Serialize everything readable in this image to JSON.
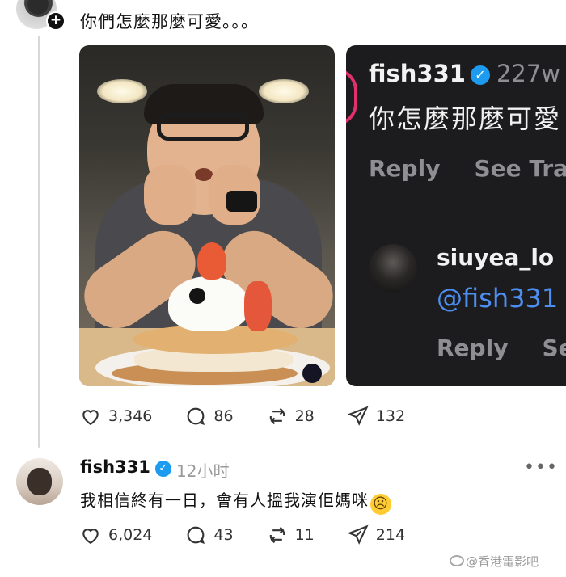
{
  "post": {
    "text": "你們怎麼那麼可愛。。。",
    "stats": {
      "likes": "3,346",
      "comments": "86",
      "reposts": "28",
      "shares": "132"
    }
  },
  "screenshot": {
    "user": "fish331",
    "time": "227w",
    "message": "你怎麼那麼可愛",
    "reply_label": "Reply",
    "see_translation": "See Tra",
    "reply_user": "siuyea_lo",
    "mention": "@fish331",
    "reply_label_2": "Reply",
    "see_2": "Se"
  },
  "reply": {
    "user": "fish331",
    "time": "12小时",
    "text": "我相信終有一日，會有人搵我演佢媽咪",
    "emoji": "☹",
    "more": "•••",
    "stats": {
      "likes": "6,024",
      "comments": "43",
      "reposts": "11",
      "shares": "214"
    }
  },
  "watermark": "@香港電影吧",
  "icons": {
    "plus": "+",
    "verified": "✓"
  },
  "colors": {
    "verified": "#1d9bf0",
    "mention": "#4d8ff0",
    "dark_bg": "#1c1c1e",
    "story_ring": "#e1306c"
  }
}
